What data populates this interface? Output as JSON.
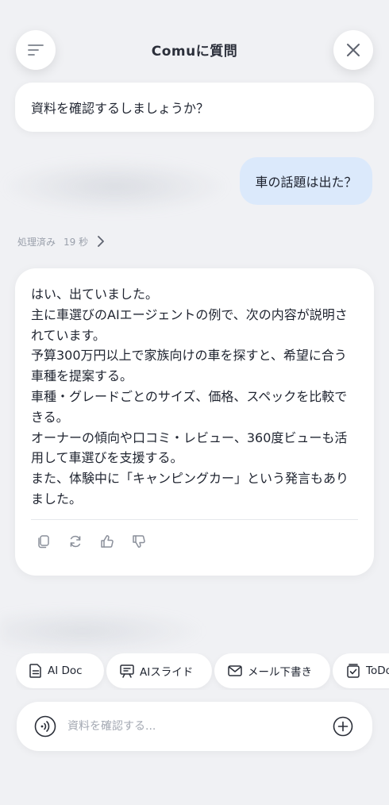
{
  "header": {
    "title": "Comuに質問"
  },
  "prompt_card": {
    "text": "資料を確認するしましょうか？"
  },
  "user_message": {
    "text": "車の話題は出た？"
  },
  "processing": {
    "label": "処理済み",
    "duration": "19 秒"
  },
  "answer": {
    "lines": [
      "はい、出ていました。",
      "主に車選びのAIエージェントの例で、次の内容が説明されています。",
      "予算300万円以上で家族向けの車を探すと、希望に合う車種を提案する。",
      "車種・グレードごとのサイズ、価格、スペックを比較できる。",
      "オーナーの傾向や口コミ・レビュー、360度ビューも活用して車選びを支援する。",
      "また、体験中に「キャンピングカー」という発言もありました。"
    ]
  },
  "actions": [
    {
      "icon": "copy-icon"
    },
    {
      "icon": "refresh-icon"
    },
    {
      "icon": "thumbs-up-icon"
    },
    {
      "icon": "thumbs-down-icon"
    }
  ],
  "chips": [
    {
      "label": "AI Doc",
      "icon": "document-icon"
    },
    {
      "label": "AIスライド",
      "icon": "slide-icon"
    },
    {
      "label": "メール下書き",
      "icon": "mail-icon"
    },
    {
      "label": "ToDo",
      "icon": "todo-icon"
    }
  ],
  "input": {
    "placeholder": "資料を確認する..."
  },
  "colors": {
    "background": "#f0f1f4",
    "user_bubble": "#dbe9fb",
    "card": "#ffffff"
  }
}
